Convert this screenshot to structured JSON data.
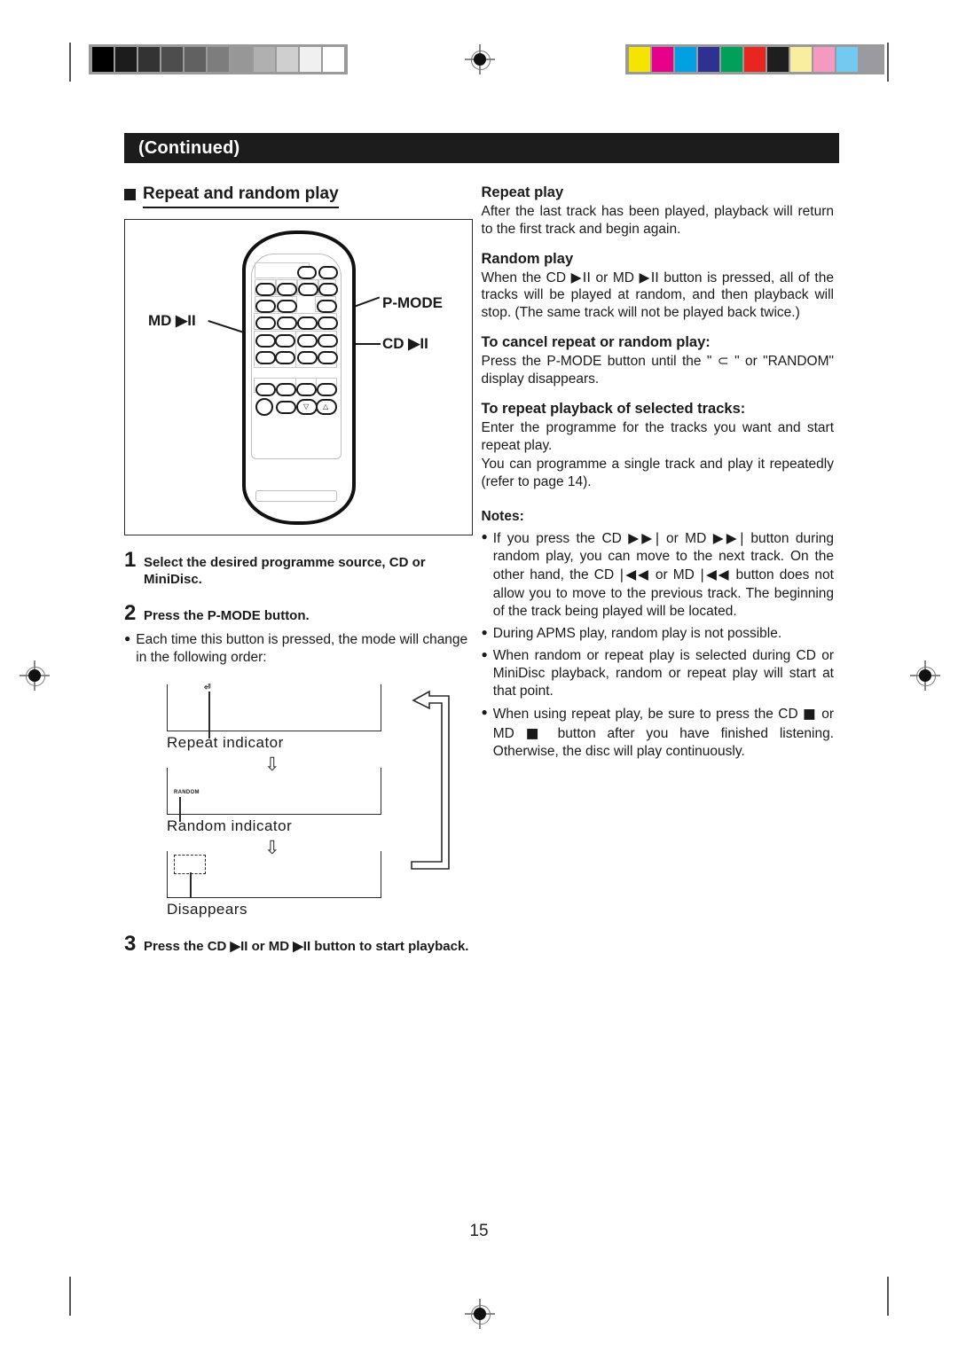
{
  "printer_marks": {
    "gray_swatches": [
      "#000000",
      "#1c1c1c",
      "#333333",
      "#4d4d4d",
      "#616161",
      "#7d7d7d",
      "#979797",
      "#b0b0b0",
      "#cfcfcf",
      "#f0f0f0",
      "#ffffff"
    ],
    "color_swatches": [
      "#f5e400",
      "#e6008c",
      "#00a0e3",
      "#2e3192",
      "#00a05a",
      "#e8251f",
      "#1e1e1e",
      "#f9eda0",
      "#f49ac1",
      "#72caf2",
      "#9a9aa0"
    ]
  },
  "header": {
    "continued_label": "(Continued)",
    "section_title": "Repeat and random play"
  },
  "remote_diagram": {
    "callouts": {
      "md_play_pause": "MD ▶II",
      "p_mode": "P-MODE",
      "cd_play_pause": "CD ▶II"
    }
  },
  "steps": [
    {
      "num": "1",
      "text": "Select the desired programme source, CD or MiniDisc."
    },
    {
      "num": "2",
      "text": "Press the P-MODE button."
    },
    {
      "num": "3",
      "text": "Press the CD ▶II or MD ▶II button to start playback."
    }
  ],
  "step2_note": "Each time this button is pressed, the mode will change in the following order:",
  "flow": {
    "repeat_indicator_glyph": "⏎",
    "repeat_label": "Repeat indicator",
    "random_indicator_glyph": "RANDOM",
    "random_label": "Random indicator",
    "disappears_label": "Disappears",
    "arrow_glyph": "⇩"
  },
  "right_column": {
    "repeat_play": {
      "heading": "Repeat play",
      "body": "After the last track has been played, playback will return to the first track and begin again."
    },
    "random_play": {
      "heading": "Random play",
      "body_pre": "When the CD",
      "icon1": "▶II",
      "body_mid": "or MD",
      "icon2": "▶II",
      "body_post": "button is pressed, all of the tracks will be played at random, and then playback will stop. (The same track will not be played back twice.)"
    },
    "cancel": {
      "heading": "To cancel repeat or random play:",
      "body_pre": "Press the P-MODE button until the \"",
      "glyph": "⊂",
      "body_post": "\" or \"RANDOM\" display disappears."
    },
    "repeat_selected": {
      "heading": "To repeat playback of selected tracks:",
      "body1": "Enter the programme for the tracks you want and start repeat play.",
      "body2": "You can programme a single track and play it repeatedly (refer to page 14)."
    },
    "notes_heading": "Notes:",
    "notes": [
      {
        "pre": "If you press the CD",
        "icon1": "▶▶|",
        "mid": "or MD",
        "icon2": "▶▶|",
        "mid2": "button during random play, you can move to the next track. On the other hand, the CD",
        "icon3": "|◀◀",
        "mid3": "or MD",
        "icon4": "|◀◀",
        "post": "button does not allow you to move to the previous track. The beginning of the track being played will be located."
      },
      {
        "pre": "During APMS play, random play is not possible."
      },
      {
        "pre": "When random or repeat play is selected during CD or MiniDisc playback, random or repeat play will start at that point."
      },
      {
        "pre": "When using repeat play, be sure to press the CD",
        "icon1": "■",
        "mid": "or MD",
        "icon2": "■",
        "post": "button after you have finished listening. Otherwise, the disc will play continuously."
      }
    ]
  },
  "page_number": "15"
}
